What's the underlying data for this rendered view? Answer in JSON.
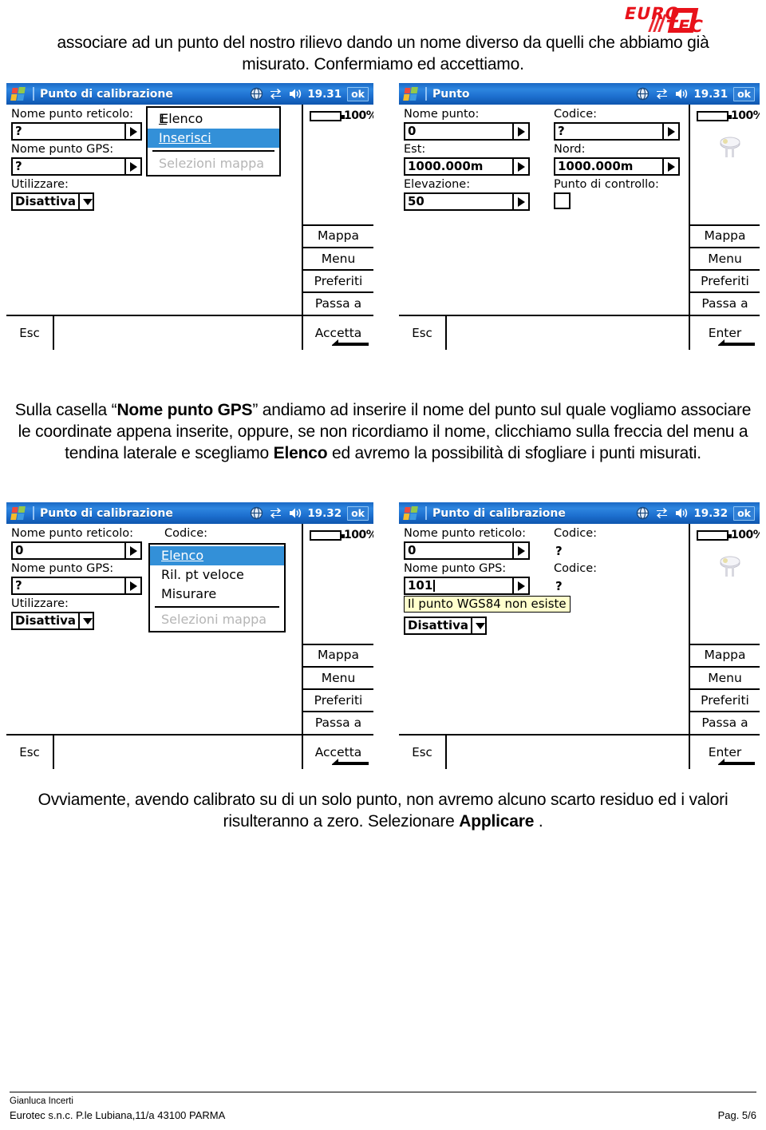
{
  "logo": {
    "alt": "EUROTEC",
    "text_left": "EURO",
    "text_right": "TEC",
    "color": "#e8121a"
  },
  "paragraphs": {
    "top": {
      "line1": "associare ad un punto del nostro rilievo dando un nome diverso da quelli che abbiamo già",
      "line2": "misurato. Confermiamo ed accettiamo."
    },
    "middle": {
      "pre1": "Sulla casella “",
      "bold1": "Nome punto GPS",
      "post1": "” andiamo ad inserire il nome del punto sul quale vogliamo associare le coordinate appena inserite, oppure, se non ricordiamo il nome, clicchiamo sulla freccia del  menu a tendina laterale e scegliamo ",
      "bold2": "Elenco",
      "post2": " ed avremo la possibilità di sfogliare i punti misurati."
    },
    "bottom": {
      "pre": "Ovviamente, avendo calibrato su di un solo punto, non avremo alcuno scarto residuo ed i valori risulteranno a zero.  Selezionare ",
      "bold": "Applicare",
      "post": " ."
    }
  },
  "windows": {
    "w1": {
      "title": "Punto di calibrazione",
      "clock": "19.31",
      "ok_label": "ok",
      "battery": "100%",
      "labels": {
        "nome_punto_reticolo": "Nome punto reticolo:",
        "nome_punto_gps": "Nome punto GPS:",
        "utilizzare": "Utilizzare:"
      },
      "values": {
        "nome_punto_reticolo": "?",
        "nome_punto_gps": "?",
        "utilizzare": "Disattiva"
      },
      "menu": [
        {
          "label": "Elenco",
          "accel": "E",
          "state": "normal"
        },
        {
          "label": "Inserisci",
          "accel": "I",
          "state": "selected"
        },
        {
          "label": "Selezioni mappa",
          "accel": "S",
          "state": "disabled",
          "separator_before": true
        }
      ],
      "sidebar": [
        "Mappa",
        "Menu",
        "Preferiti",
        "Passa a"
      ],
      "esc_label": "Esc",
      "action_label": "Accetta"
    },
    "w2": {
      "title": "Punto",
      "clock": "19.31",
      "ok_label": "ok",
      "battery": "100%",
      "labels": {
        "nome_punto": "Nome punto:",
        "codice": "Codice:",
        "est": "Est:",
        "nord": "Nord:",
        "elevazione": "Elevazione:",
        "punto_di_controllo": "Punto di controllo:"
      },
      "values": {
        "nome_punto": "0",
        "codice": "?",
        "est": "1000.000m",
        "nord": "1000.000m",
        "elevazione": "50",
        "punto_di_controllo": ""
      },
      "sidebar": [
        "Mappa",
        "Menu",
        "Preferiti",
        "Passa a"
      ],
      "esc_label": "Esc",
      "action_label": "Enter"
    },
    "w3": {
      "title": "Punto di calibrazione",
      "clock": "19.32",
      "ok_label": "ok",
      "battery": "100%",
      "labels": {
        "nome_punto_reticolo": "Nome punto reticolo:",
        "codice": "Codice:",
        "nome_punto_gps": "Nome punto GPS:",
        "utilizzare": "Utilizzare:"
      },
      "values": {
        "nome_punto_reticolo": "0",
        "nome_punto_gps": "?",
        "utilizzare": "Disattiva"
      },
      "menu": [
        {
          "label": "Elenco",
          "accel": "E",
          "state": "selected"
        },
        {
          "label": "Ril. pt veloce",
          "accel": "Ri",
          "state": "normal"
        },
        {
          "label": "Misurare",
          "accel": "M",
          "state": "normal"
        },
        {
          "label": "Selezioni mappa",
          "accel": "S",
          "state": "disabled",
          "separator_before": true
        }
      ],
      "sidebar": [
        "Mappa",
        "Menu",
        "Preferiti",
        "Passa a"
      ],
      "esc_label": "Esc",
      "action_label": "Accetta"
    },
    "w4": {
      "title": "Punto di calibrazione",
      "clock": "19.32",
      "ok_label": "ok",
      "battery": "100%",
      "labels": {
        "nome_punto_reticolo": "Nome punto reticolo:",
        "codice1": "Codice:",
        "nome_punto_gps": "Nome punto GPS:",
        "codice2": "Codice:"
      },
      "values": {
        "nome_punto_reticolo": "0",
        "codice1": "?",
        "nome_punto_gps": "101",
        "codice2": "?",
        "utilizzare": "Disattiva"
      },
      "tooltip": "Il punto WGS84 non esiste",
      "sidebar": [
        "Mappa",
        "Menu",
        "Preferiti",
        "Passa a"
      ],
      "esc_label": "Esc",
      "action_label": "Enter"
    }
  },
  "footer": {
    "author": "Gianluca Incerti",
    "company": "Eurotec s.n.c. P.le Lubiana,11/a 43100 PARMA",
    "page": "Pag. 5/6"
  }
}
